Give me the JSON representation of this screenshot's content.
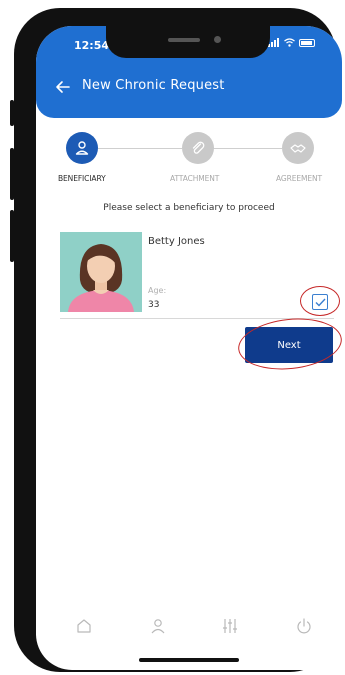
{
  "status_bar": {
    "time": "12:54"
  },
  "header": {
    "title": "New Chronic Request"
  },
  "stepper": {
    "steps": [
      {
        "label": "BENEFICIARY",
        "icon": "person-icon",
        "active": true
      },
      {
        "label": "ATTACHMENT",
        "icon": "paperclip-icon",
        "active": false
      },
      {
        "label": "AGREEMENT",
        "icon": "handshake-icon",
        "active": false
      }
    ]
  },
  "prompt": "Please select a beneficiary to proceed",
  "beneficiary": {
    "name": "Betty Jones",
    "age_label": "Age:",
    "age_value": "33",
    "selected": true
  },
  "next_button": {
    "label": "Next"
  },
  "bottom_nav": [
    "home-icon",
    "profile-icon",
    "settings-sliders-icon",
    "power-icon"
  ],
  "colors": {
    "header": "#1f6fd1",
    "step_active": "#1d5bb5",
    "step_inactive": "#c9c9c9",
    "next_button": "#0f3b8c",
    "annotation": "#c62828"
  }
}
